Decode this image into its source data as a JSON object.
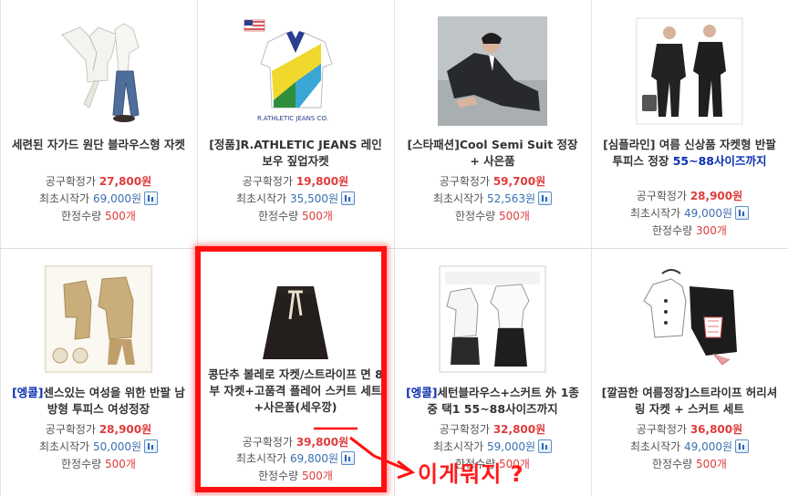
{
  "labels": {
    "group_price": "공구확정가",
    "start_price": "최초시작가",
    "limit_qty": "한정수량"
  },
  "products": [
    {
      "tag": "",
      "title": "세련된 자가드 원단 블라우스형 자켓",
      "price": "27,800원",
      "start": "69,000원",
      "qty": "500개",
      "thumb": "white-blouse-jeans"
    },
    {
      "tag": "",
      "title": "[정품]R.ATHLETIC JEANS 레인보우 짚업자켓",
      "price": "19,800원",
      "start": "35,500원",
      "qty": "500개",
      "thumb": "rainbow-zipup-jacket"
    },
    {
      "tag": "",
      "title": "[스타패션]Cool Semi Suit 정장 + 사은품",
      "price": "59,700원",
      "start": "52,563원",
      "qty": "500개",
      "thumb": "man-in-suit"
    },
    {
      "tag": "",
      "title_main": "[심플라인] 여름 신상품 자켓형 반팔 투피스 정장 ",
      "title_accent": "55~88사이즈까지",
      "price": "28,900원",
      "start": "49,000원",
      "qty": "300개",
      "thumb": "black-two-piece"
    },
    {
      "tag": "[엥콜]",
      "title": "센스있는 여성을 위한 반팔 남방형 투피스 여성정장",
      "price": "28,900원",
      "start": "50,000원",
      "qty": "500개",
      "thumb": "beige-suit"
    },
    {
      "tag": "",
      "title": "콩단추 볼레로 자켓/스트라이프 면 8부 자켓+고품격 플레어 스커트 세트+사은품(세우깡)",
      "price": "39,800원",
      "start": "69,800원",
      "qty": "500개",
      "thumb": "black-flare-skirt"
    },
    {
      "tag": "[엥콜]",
      "title": "세턴블라우스+스커트 外 1종 중 택1 55~88사이즈까지",
      "price": "32,800원",
      "start": "59,000원",
      "qty": "500개",
      "thumb": "blouse-skirt-set"
    },
    {
      "tag": "",
      "title": "[깔끔한 여름정장]스트라이프 허리셔링 자켓 + 스커트 세트",
      "price": "36,800원",
      "start": "49,000원",
      "qty": "500개",
      "thumb": "white-jacket-black-skirt"
    }
  ],
  "annotation": {
    "text": "이게뭐지 ?",
    "color": "#ff1a1a"
  }
}
